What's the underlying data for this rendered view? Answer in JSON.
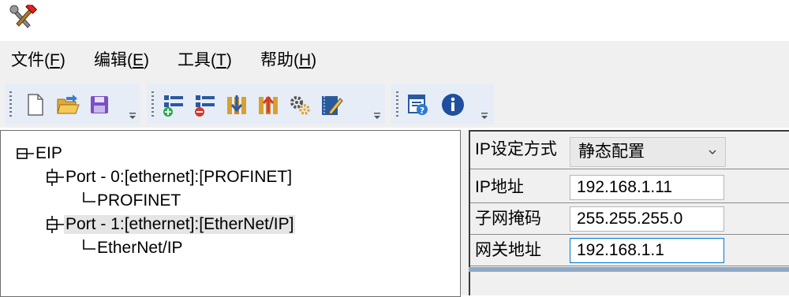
{
  "app": {
    "icon": "tools-hammer-wrench-icon"
  },
  "menu": [
    {
      "label": "文件(",
      "mnemonic": "F",
      "suffix": ")"
    },
    {
      "label": "编辑(",
      "mnemonic": "E",
      "suffix": ")"
    },
    {
      "label": "工具(",
      "mnemonic": "T",
      "suffix": ")"
    },
    {
      "label": "帮助(",
      "mnemonic": "H",
      "suffix": ")"
    }
  ],
  "toolbar": {
    "groups": [
      {
        "buttons": [
          "new-file-icon",
          "open-folder-icon",
          "save-icon"
        ]
      },
      {
        "buttons": [
          "add-node-icon",
          "remove-node-icon",
          "download-icon",
          "upload-icon",
          "settings-gears-icon",
          "edit-notebook-icon"
        ]
      },
      {
        "buttons": [
          "help-window-icon",
          "info-icon"
        ]
      }
    ]
  },
  "tree": {
    "root": "EIP",
    "ports": [
      {
        "label": "Port - 0:[ethernet]:[PROFINET]",
        "child": "PROFINET",
        "selected": false
      },
      {
        "label": "Port - 1:[ethernet]:[EtherNet/IP]",
        "child": "EtherNet/IP",
        "selected": true
      }
    ]
  },
  "properties": {
    "mode_label": "IP设定方式",
    "mode_value": "静态配置",
    "ip_label": "IP地址",
    "ip_value": "192.168.1.11",
    "mask_label": "子网掩码",
    "mask_value": "255.255.255.0",
    "gateway_label": "网关地址",
    "gateway_value": "192.168.1.1"
  },
  "colors": {
    "toolbar_group_bg": "#e6edf7",
    "focus_border": "#0078d7",
    "selection_bg": "#e5e5e5"
  }
}
